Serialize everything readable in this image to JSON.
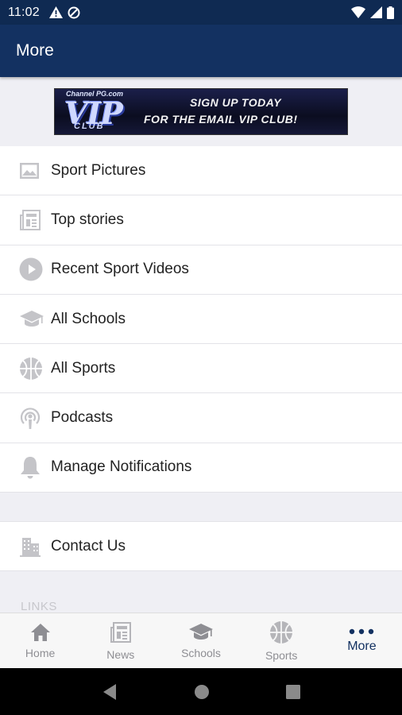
{
  "status_bar": {
    "time": "11:02"
  },
  "app_bar": {
    "title": "More"
  },
  "banner": {
    "site": "Channel PG.com",
    "vip": "VIP",
    "club": "CLUB",
    "line1": "SIGN UP TODAY",
    "line2": "FOR THE EMAIL VIP CLUB!"
  },
  "menu": {
    "items": [
      {
        "label": "Sport Pictures",
        "icon": "image-icon"
      },
      {
        "label": "Top stories",
        "icon": "newspaper-icon"
      },
      {
        "label": "Recent Sport Videos",
        "icon": "play-circle-icon"
      },
      {
        "label": "All Schools",
        "icon": "graduation-cap-icon"
      },
      {
        "label": "All Sports",
        "icon": "basketball-icon"
      },
      {
        "label": "Podcasts",
        "icon": "podcast-icon"
      },
      {
        "label": "Manage Notifications",
        "icon": "bell-icon"
      }
    ]
  },
  "contact": {
    "label": "Contact Us",
    "icon": "building-icon"
  },
  "links_section": {
    "label": "LINKS"
  },
  "tabs": [
    {
      "label": "Home",
      "icon": "home-icon"
    },
    {
      "label": "News",
      "icon": "newspaper-icon"
    },
    {
      "label": "Schools",
      "icon": "graduation-cap-icon"
    },
    {
      "label": "Sports",
      "icon": "basketball-icon"
    },
    {
      "label": "More",
      "icon": "more-dots-icon",
      "active": true
    }
  ],
  "colors": {
    "primary": "#133161",
    "status_bar": "#0f2a52",
    "icon_gray": "#b8b8bc",
    "tab_inactive": "#8e8e93"
  }
}
